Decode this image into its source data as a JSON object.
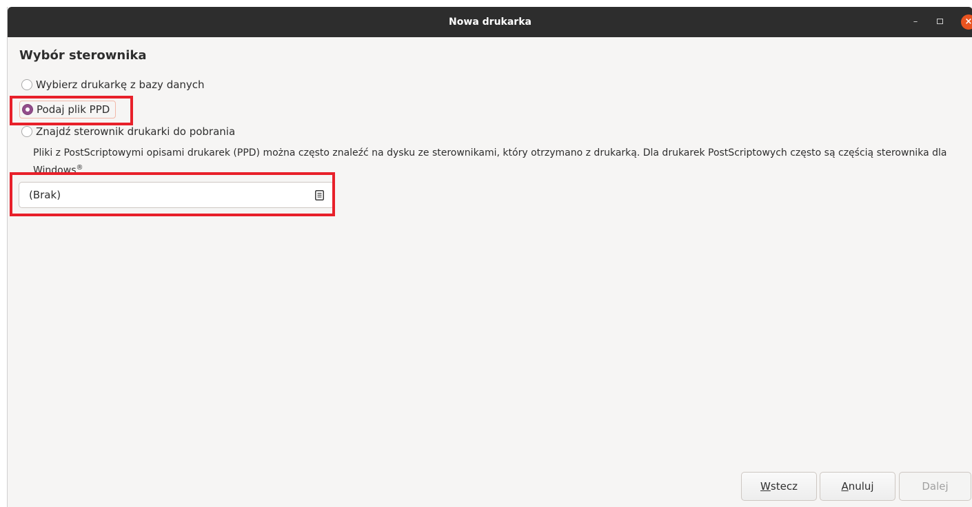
{
  "window": {
    "title": "Nowa drukarka",
    "minimize": "–",
    "close": "×"
  },
  "page": {
    "heading": "Wybór sterownika",
    "options": [
      {
        "label": "Wybierz drukarkę z bazy danych",
        "selected": false
      },
      {
        "label": "Podaj plik PPD",
        "selected": true
      },
      {
        "label": "Znajdź sterownik drukarki do pobrania",
        "selected": false
      }
    ],
    "description": "Pliki z PostScriptowymi opisami drukarek (PPD) można często znaleźć na dysku ze sterownikami, który otrzymano z drukarką. Dla drukarek PostScriptowych często są częścią sterownika dla Windows",
    "description_mark": "®",
    "file_chooser_value": "(Brak)"
  },
  "buttons": {
    "back_mnemonic": "W",
    "back_rest": "stecz",
    "cancel_mnemonic": "A",
    "cancel_rest": "nuluj",
    "next": "Dalej"
  },
  "colors": {
    "accent": "#924d8b",
    "highlight": "#e8202a",
    "titlebar": "#2d2d2d",
    "close": "#e95420"
  }
}
